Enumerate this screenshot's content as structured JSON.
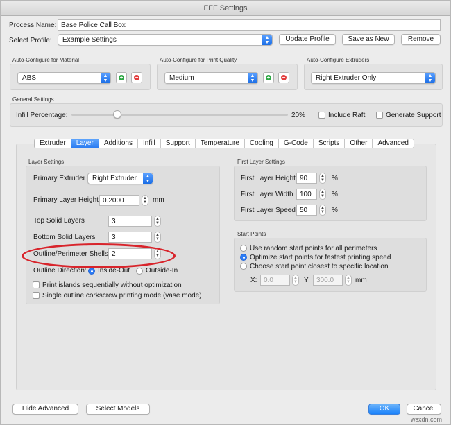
{
  "window": {
    "title": "FFF Settings"
  },
  "top": {
    "process_name_label": "Process Name:",
    "process_name_value": "Base Police Call Box",
    "select_profile_label": "Select Profile:",
    "select_profile_value": "Example Settings",
    "update_profile": "Update Profile",
    "save_as_new": "Save as New",
    "remove": "Remove"
  },
  "auto_configure": {
    "material": {
      "label": "Auto-Configure for Material",
      "value": "ABS"
    },
    "quality": {
      "label": "Auto-Configure for Print Quality",
      "value": "Medium"
    },
    "extruders": {
      "label": "Auto-Configure Extruders",
      "value": "Right Extruder Only"
    }
  },
  "general": {
    "group_label": "General Settings",
    "infill_label": "Infill Percentage:",
    "infill_value": "20%",
    "infill_level": 0.2,
    "include_raft": "Include Raft",
    "generate_support": "Generate Support"
  },
  "tabs": [
    "Extruder",
    "Layer",
    "Additions",
    "Infill",
    "Support",
    "Temperature",
    "Cooling",
    "G-Code",
    "Scripts",
    "Other",
    "Advanced"
  ],
  "active_tab": "Layer",
  "layer_settings": {
    "group_label": "Layer Settings",
    "primary_extruder_label": "Primary Extruder",
    "primary_extruder_value": "Right Extruder",
    "primary_layer_height_label": "Primary Layer Height",
    "primary_layer_height_value": "0.2000",
    "primary_layer_height_unit": "mm",
    "top_solid_label": "Top Solid Layers",
    "top_solid_value": "3",
    "bottom_solid_label": "Bottom Solid Layers",
    "bottom_solid_value": "3",
    "shells_label": "Outline/Perimeter Shells",
    "shells_value": "2",
    "outline_direction_label": "Outline Direction:",
    "inside_out": "Inside-Out",
    "outside_in": "Outside-In",
    "print_islands": "Print islands sequentially without optimization",
    "vase_mode": "Single outline corkscrew printing mode (vase mode)"
  },
  "first_layer": {
    "group_label": "First Layer Settings",
    "height_label": "First Layer Height",
    "height_value": "90",
    "width_label": "First Layer Width",
    "width_value": "100",
    "speed_label": "First Layer Speed",
    "speed_value": "50",
    "unit": "%"
  },
  "start_points": {
    "group_label": "Start Points",
    "random": "Use random start points for all perimeters",
    "optimize": "Optimize start points for fastest printing speed",
    "closest": "Choose start point closest to specific location",
    "x_label": "X:",
    "x_value": "0.0",
    "y_label": "Y:",
    "y_value": "300.0",
    "unit": "mm"
  },
  "bottom": {
    "hide_advanced": "Hide Advanced",
    "select_models": "Select Models",
    "ok": "OK",
    "cancel": "Cancel"
  },
  "watermark": "wsxdn.com",
  "colors": {
    "accent": "#2c7cf6",
    "highlight": "#d8242b"
  }
}
